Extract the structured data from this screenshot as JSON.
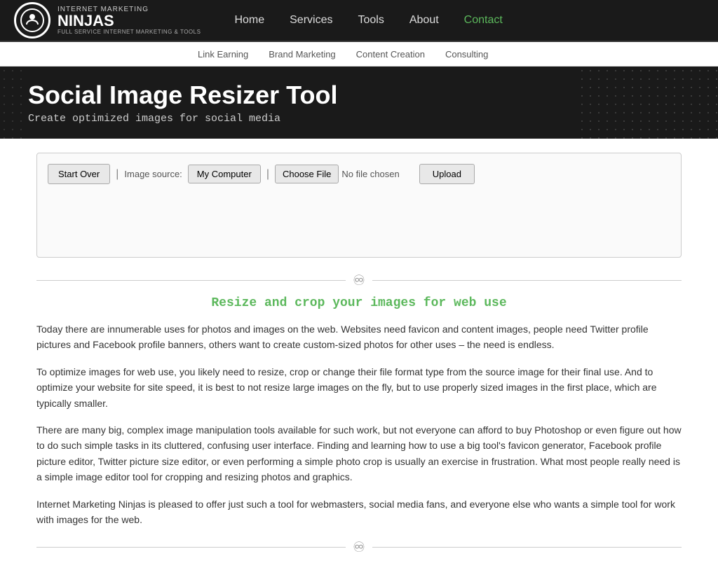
{
  "logo": {
    "brand_line": "INTERNET MARKETING",
    "name": "NINJAS",
    "tagline": "FULL SERVICE INTERNET MARKETING & TOOLS"
  },
  "nav": {
    "main_items": [
      {
        "label": "Home",
        "href": "#",
        "active": false
      },
      {
        "label": "Services",
        "href": "#",
        "active": false
      },
      {
        "label": "Tools",
        "href": "#",
        "active": false
      },
      {
        "label": "About",
        "href": "#",
        "active": false
      },
      {
        "label": "Contact",
        "href": "#",
        "active": true
      }
    ],
    "sub_items": [
      {
        "label": "Link Earning",
        "href": "#"
      },
      {
        "label": "Brand Marketing",
        "href": "#"
      },
      {
        "label": "Content Creation",
        "href": "#"
      },
      {
        "label": "Consulting",
        "href": "#"
      }
    ]
  },
  "hero": {
    "title": "Social Image Resizer Tool",
    "subtitle": "Create optimized images for social media"
  },
  "tool": {
    "start_over_label": "Start Over",
    "image_source_label": "Image source:",
    "my_computer_label": "My Computer",
    "choose_file_label": "Choose File",
    "no_file_label": "No file chosen",
    "upload_label": "Upload"
  },
  "content": {
    "section_title": "Resize and crop your images for web use",
    "paragraph1": "Today there are innumerable uses for photos and images on the web. Websites need favicon and content images, people need Twitter profile pictures and Facebook profile banners, others want to create custom-sized photos for other uses – the need is endless.",
    "paragraph2": "To optimize images for web use, you likely need to resize, crop or change their file format type from the source image for their final use. And to optimize your website for site speed, it is best to not resize large images on the fly, but to use properly sized images in the first place, which are typically smaller.",
    "paragraph3": "There are many big, complex image manipulation tools available for such work, but not everyone can afford to buy Photoshop or even figure out how to do such simple tasks in its cluttered, confusing user interface. Finding and learning how to use a big tool's favicon generator, Facebook profile picture editor, Twitter picture size editor, or even performing a simple photo crop is usually an exercise in frustration. What most people really need is a simple image editor tool for cropping and resizing photos and graphics.",
    "paragraph4": "Internet Marketing Ninjas is pleased to offer just such a tool for webmasters, social media fans, and everyone else who wants a simple tool for work with images for the web."
  }
}
